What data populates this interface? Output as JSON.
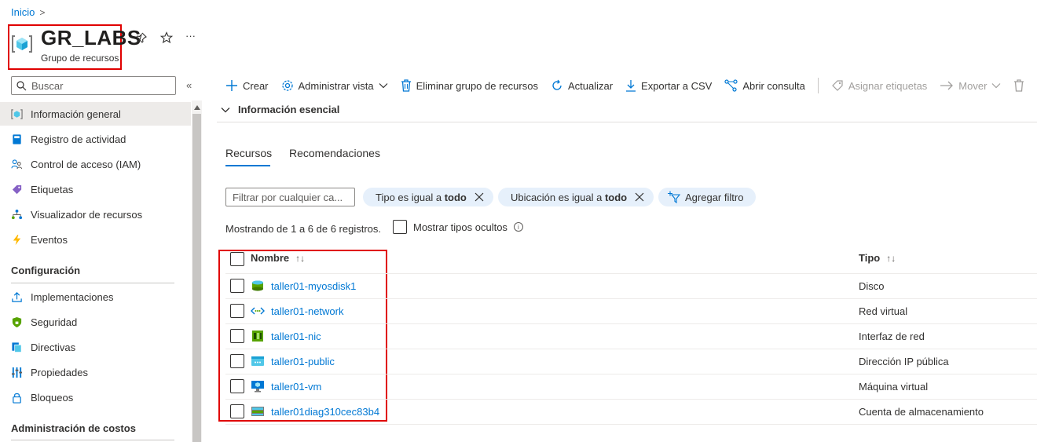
{
  "breadcrumb": {
    "home": "Inicio",
    "chevron": ">"
  },
  "header": {
    "title": "GR_LABS",
    "subtitle": "Grupo de recursos",
    "more": "···"
  },
  "search": {
    "placeholder": "Buscar",
    "collapse": "«"
  },
  "nav": {
    "items": [
      {
        "label": "Información general",
        "icon": "resource-group-icon",
        "active": true
      },
      {
        "label": "Registro de actividad",
        "icon": "book-icon"
      },
      {
        "label": "Control de acceso (IAM)",
        "icon": "people-icon"
      },
      {
        "label": "Etiquetas",
        "icon": "tag-icon"
      },
      {
        "label": "Visualizador de recursos",
        "icon": "hierarchy-icon"
      },
      {
        "label": "Eventos",
        "icon": "lightning-icon"
      }
    ],
    "section_config": "Configuración",
    "config_items": [
      {
        "label": "Implementaciones",
        "icon": "upload-icon"
      },
      {
        "label": "Seguridad",
        "icon": "shield-icon"
      },
      {
        "label": "Directivas",
        "icon": "policy-icon"
      },
      {
        "label": "Propiedades",
        "icon": "properties-icon"
      },
      {
        "label": "Bloqueos",
        "icon": "lock-icon"
      }
    ],
    "section_costs": "Administración de costos"
  },
  "toolbar": {
    "create": "Crear",
    "manage_view": "Administrar vista",
    "delete_group": "Eliminar grupo de recursos",
    "refresh": "Actualizar",
    "export_csv": "Exportar a CSV",
    "open_query": "Abrir consulta",
    "assign_tags": "Asignar etiquetas",
    "move": "Mover"
  },
  "essentials": {
    "label": "Información esencial"
  },
  "tabs": {
    "resources": "Recursos",
    "recommendations": "Recomendaciones"
  },
  "filters": {
    "placeholder": "Filtrar por cualquier ca...",
    "type_prefix": "Tipo es igual a ",
    "type_value": "todo",
    "location_prefix": "Ubicación es igual a ",
    "location_value": "todo",
    "add_filter": "Agregar filtro"
  },
  "listing": {
    "showing": "Mostrando de 1 a 6 de 6 registros.",
    "show_hidden": "Mostrar tipos ocultos",
    "info": "i"
  },
  "table": {
    "col_name": "Nombre",
    "col_type": "Tipo",
    "sort_glyph": "↑↓",
    "rows": [
      {
        "name": "taller01-myosdisk1",
        "type": "Disco",
        "icon": "disk-icon"
      },
      {
        "name": "taller01-network",
        "type": "Red virtual",
        "icon": "vnet-icon"
      },
      {
        "name": "taller01-nic",
        "type": "Interfaz de red",
        "icon": "nic-icon"
      },
      {
        "name": "taller01-public",
        "type": "Dirección IP pública",
        "icon": "public-ip-icon"
      },
      {
        "name": "taller01-vm",
        "type": "Máquina virtual",
        "icon": "vm-icon"
      },
      {
        "name": "taller01diag310cec83b4",
        "type": "Cuenta de almacenamiento",
        "icon": "storage-icon"
      }
    ]
  },
  "colors": {
    "accent": "#0078d4",
    "highlight_border": "#e00000",
    "pill_bg": "#e6f0fb"
  }
}
